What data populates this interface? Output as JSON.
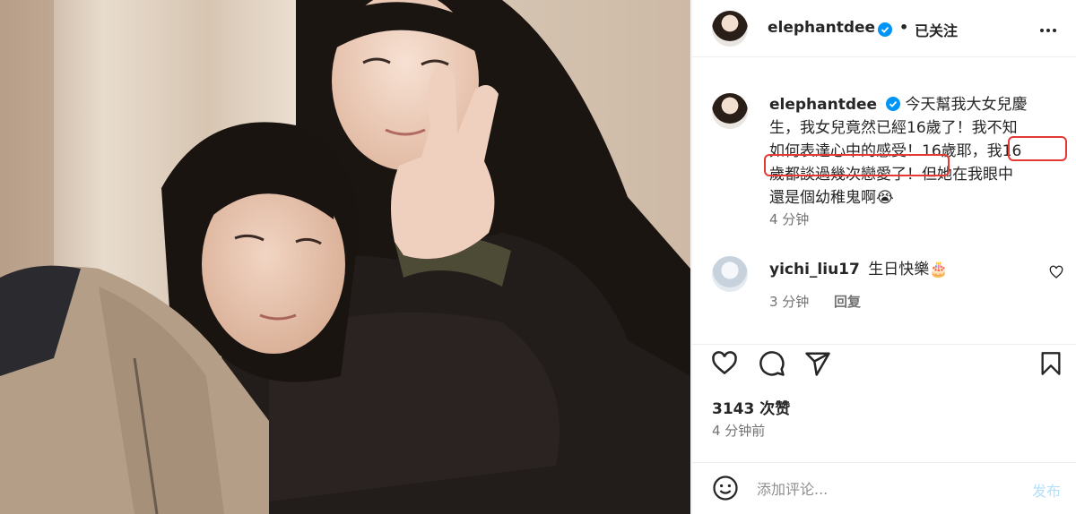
{
  "header": {
    "username": "elephantdee",
    "separator": "•",
    "follow_state": "已关注"
  },
  "caption": {
    "username": "elephantdee",
    "line1": "今天幫我大女兒慶",
    "line2": "生，我女兒竟然已經16歲了！我不知",
    "line3": "如何表達心中的感受！16歲耶，我16",
    "line4": "歲都談過幾次戀愛了！但她在我眼中",
    "line5": "還是個幼稚鬼啊😭",
    "time": "4 分钟"
  },
  "comment": {
    "username": "yichi_liu17",
    "text": "生日快樂🎂",
    "time": "3 分钟",
    "reply_label": "回复"
  },
  "likes": "3143 次赞",
  "post_time": "4 分钟前",
  "comment_input": {
    "placeholder": "添加评论..."
  },
  "post_button": "发布",
  "colors": {
    "verified": "#0095f6",
    "highlight": "#e53935",
    "post_disabled": "#b2dffc"
  }
}
